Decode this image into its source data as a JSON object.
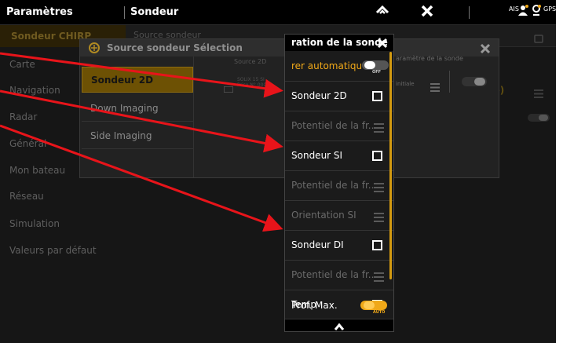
{
  "topbar": {
    "title": "Paramètres",
    "subtitle": "Sondeur",
    "ais": "AIS",
    "gps": "GPS"
  },
  "background": {
    "section_title": "Sondeur CHIRP",
    "section_sub": "Source sondeur",
    "categories": [
      "Carte",
      "Navigation",
      "Radar",
      "Général",
      "Mon bateau",
      "Réseau",
      "Simulation",
      "Valeurs par défaut"
    ],
    "right_value": "de)"
  },
  "source_dialog": {
    "title": "Source sondeur Sélection",
    "items": [
      "Sondeur 2D",
      "Down Imaging",
      "Side Imaging"
    ],
    "right_label": "Source 2D",
    "device_line1": "SOLIX 15 SI",
    "device_line2": "Prise N° 0000",
    "param_label": "aramètre de la sonde",
    "initial_label": "initiale"
  },
  "config_panel": {
    "title": "ration de la sonde",
    "rows": [
      {
        "label": "rer automatique",
        "control": "toggle",
        "state": "OFF",
        "dim": false,
        "accent": true
      },
      {
        "label": "Sondeur 2D",
        "control": "checkbox",
        "dim": false
      },
      {
        "label": "Potentiel de la fr...",
        "control": "lines",
        "dim": true
      },
      {
        "label": "Sondeur SI",
        "control": "checkbox",
        "dim": false
      },
      {
        "label": "Potentiel de la fr...",
        "control": "lines",
        "dim": true
      },
      {
        "label": "Orientation SI",
        "control": "lines",
        "dim": true
      },
      {
        "label": "Sondeur DI",
        "control": "checkbox",
        "dim": false
      },
      {
        "label": "Potentiel de la fr...",
        "control": "lines",
        "dim": true
      },
      {
        "label": "Temp",
        "control": "checkbox",
        "dim": false
      },
      {
        "label": "Prof. Max.",
        "control": "toggle",
        "state": "AUTO",
        "dim": false
      }
    ]
  },
  "colors": {
    "accent": "#f0a818",
    "annotation": "#e8141a"
  }
}
